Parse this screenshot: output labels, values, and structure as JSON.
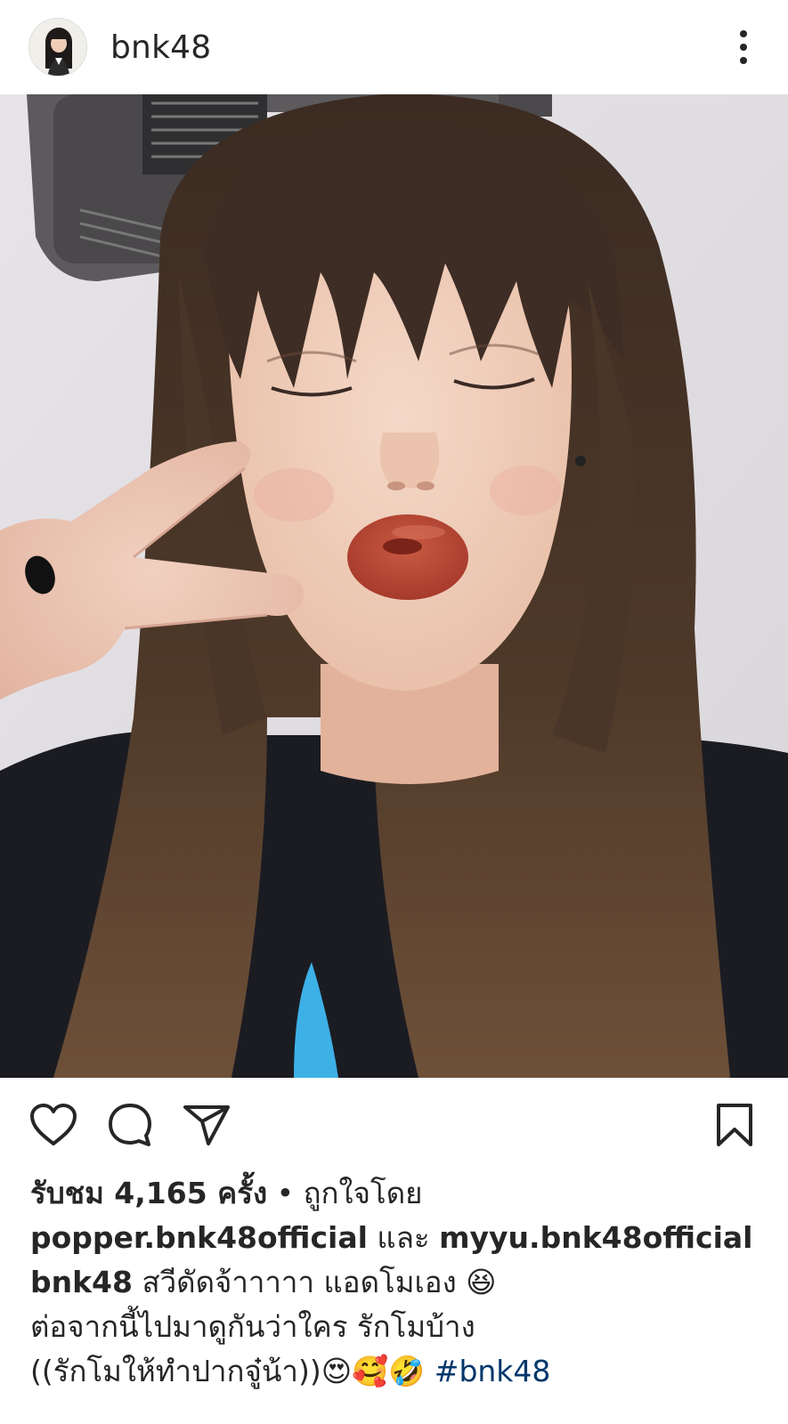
{
  "header": {
    "username": "bnk48",
    "avatar_icon": "profile-avatar",
    "more_icon": "more-vertical-icon"
  },
  "actions": {
    "like_icon": "heart-icon",
    "comment_icon": "comment-icon",
    "share_icon": "send-icon",
    "save_icon": "bookmark-icon"
  },
  "stats": {
    "views_label": "รับชม 4,165 ครั้ง",
    "separator": " • ",
    "liked_by_prefix": "ถูกใจโดย"
  },
  "liked_by": {
    "user1": "popper.bnk48official",
    "connector": " และ ",
    "user2": "myyu.bnk48official"
  },
  "caption": {
    "username": "bnk48",
    "line1": " สวีดัดจ้าาาาา แอดโมเอง 😆",
    "line2": "ต่อจากนี้ไปมาดูกันว่าใคร รักโมบ้าง",
    "line3": "((รักโมให้ทำปากจู๋น้า))😍🥰🤣 ",
    "hashtag": "#bnk48"
  },
  "colors": {
    "text": "#262626",
    "hashtag": "#00376b",
    "background": "#ffffff"
  }
}
